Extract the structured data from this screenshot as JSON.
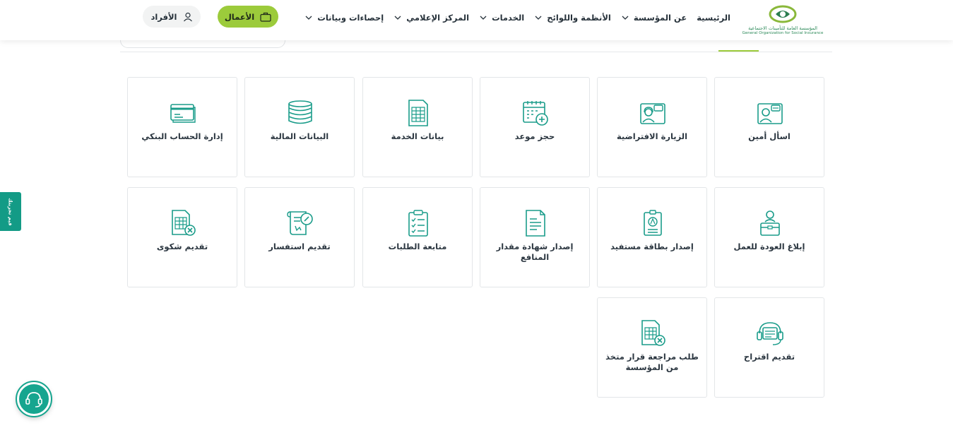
{
  "header": {
    "logo_ar": "المؤسسة العامة للتأمينات الاجتماعية",
    "logo_en": "General Organization for Social Insurance",
    "nav": [
      {
        "label": "الرئيسية",
        "has_dropdown": false
      },
      {
        "label": "عن المؤسسة",
        "has_dropdown": true
      },
      {
        "label": "الأنظمة واللوائح",
        "has_dropdown": true
      },
      {
        "label": "الخدمات",
        "has_dropdown": true
      },
      {
        "label": "المركز الإعلامي",
        "has_dropdown": true
      },
      {
        "label": "إحصاءات وبيانات",
        "has_dropdown": true
      }
    ],
    "business_label": "الأعمال",
    "individuals_label": "الأفراد"
  },
  "services": [
    {
      "label": "اسأل أمين",
      "icon": "chat-agent-icon"
    },
    {
      "label": "الزيارة الافتراضية",
      "icon": "virtual-visit-icon"
    },
    {
      "label": "حجز موعد",
      "icon": "calendar-add-icon"
    },
    {
      "label": "بيانات الخدمة",
      "icon": "document-table-icon"
    },
    {
      "label": "البيانات المالية",
      "icon": "coins-icon"
    },
    {
      "label": "إدارة الحساب البنكي",
      "icon": "bank-card-icon"
    },
    {
      "label": "إبلاغ العودة للعمل",
      "icon": "worker-briefcase-icon"
    },
    {
      "label": "إصدار بطاقة مستفيد",
      "icon": "id-badge-icon"
    },
    {
      "label": "إصدار شهادة مقدار المنافع",
      "icon": "certificate-icon"
    },
    {
      "label": "متابعة الطلبات",
      "icon": "checklist-icon"
    },
    {
      "label": "تقديم استفسار",
      "icon": "inquiry-scroll-icon"
    },
    {
      "label": "تقديم شكوى",
      "icon": "complaint-document-icon"
    },
    {
      "label": "تقديم اقتراح",
      "icon": "suggestion-support-icon"
    },
    {
      "label": "طلب مراجعة قرار متخذ من المؤسسة",
      "icon": "review-decision-icon"
    }
  ],
  "side_tab_label": "قيم تجربتك",
  "colors": {
    "brand_green": "#9ccb3b",
    "teal": "#139b86",
    "icon_teal": "#1a9c8a"
  }
}
